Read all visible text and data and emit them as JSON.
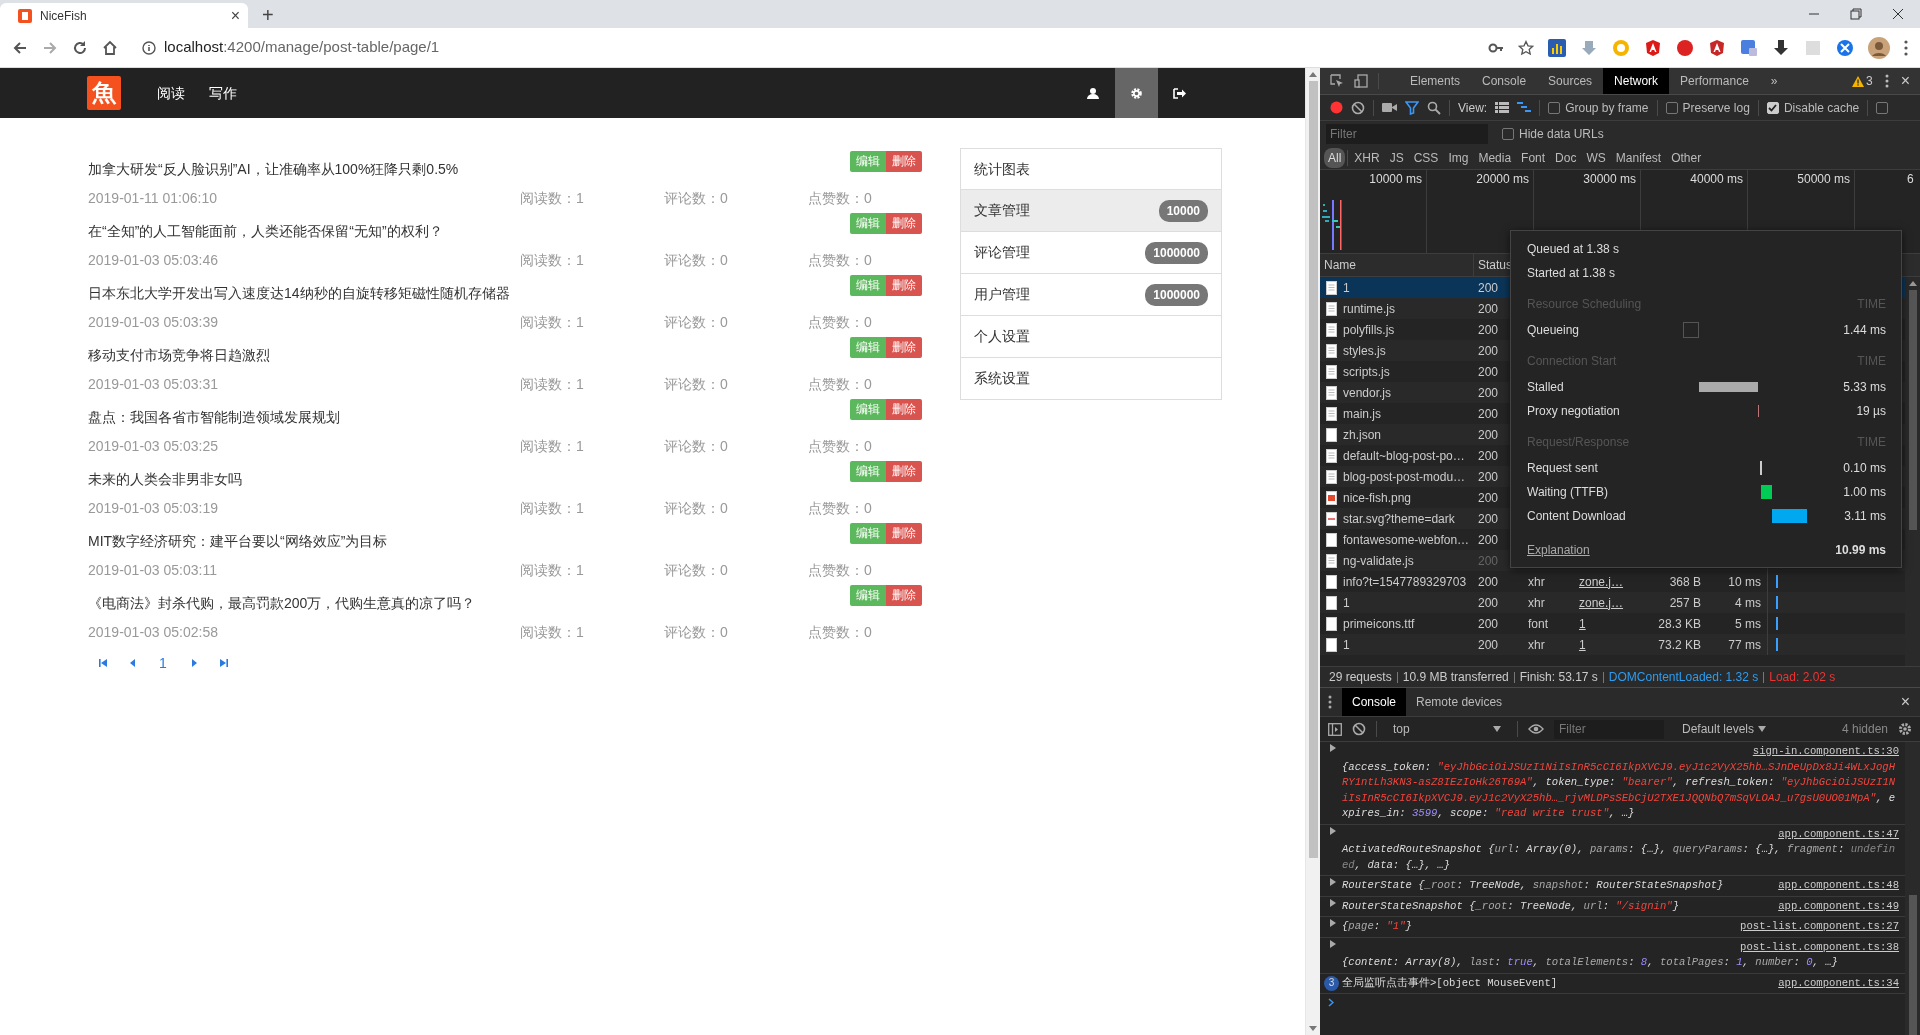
{
  "browser": {
    "tab_title": "NiceFish",
    "tab_close": "×",
    "new_tab": "+",
    "url_host": "localhost",
    "url_path": ":4200/manage/post-table/page/1"
  },
  "navbar": {
    "logo": "魚",
    "links": [
      {
        "label": "阅读"
      },
      {
        "label": "写作"
      }
    ],
    "actions": [
      {
        "kind": "user",
        "selected": false
      },
      {
        "kind": "gear",
        "selected": true
      },
      {
        "kind": "signout",
        "selected": false
      }
    ]
  },
  "posts": [
    {
      "title": "加拿大研发“反人脸识别”AI，让准确率从100%狂降只剩0.5%",
      "date": "2019-01-11 01:06:10",
      "reads": "阅读数：1",
      "comments": "评论数：0",
      "likes": "点赞数：0",
      "edit": "编辑",
      "delete": "删除"
    },
    {
      "title": "在“全知”的人工智能面前，人类还能否保留“无知”的权利？",
      "date": "2019-01-03 05:03:46",
      "reads": "阅读数：1",
      "comments": "评论数：0",
      "likes": "点赞数：0",
      "edit": "编辑",
      "delete": "删除"
    },
    {
      "title": "日本东北大学开发出写入速度达14纳秒的自旋转移矩磁性随机存储器",
      "date": "2019-01-03 05:03:39",
      "reads": "阅读数：1",
      "comments": "评论数：0",
      "likes": "点赞数：0",
      "edit": "编辑",
      "delete": "删除"
    },
    {
      "title": "移动支付市场竞争将日趋激烈",
      "date": "2019-01-03 05:03:31",
      "reads": "阅读数：1",
      "comments": "评论数：0",
      "likes": "点赞数：0",
      "edit": "编辑",
      "delete": "删除"
    },
    {
      "title": "盘点：我国各省市智能制造领域发展规划",
      "date": "2019-01-03 05:03:25",
      "reads": "阅读数：1",
      "comments": "评论数：0",
      "likes": "点赞数：0",
      "edit": "编辑",
      "delete": "删除"
    },
    {
      "title": "未来的人类会非男非女吗",
      "date": "2019-01-03 05:03:19",
      "reads": "阅读数：1",
      "comments": "评论数：0",
      "likes": "点赞数：0",
      "edit": "编辑",
      "delete": "删除"
    },
    {
      "title": "MIT数字经济研究：建平台要以“网络效应”为目标",
      "date": "2019-01-03 05:03:11",
      "reads": "阅读数：1",
      "comments": "评论数：0",
      "likes": "点赞数：0",
      "edit": "编辑",
      "delete": "删除"
    },
    {
      "title": "《电商法》封杀代购，最高罚款200万，代购生意真的凉了吗？",
      "date": "2019-01-03 05:02:58",
      "reads": "阅读数：1",
      "comments": "评论数：0",
      "likes": "点赞数：0",
      "edit": "编辑",
      "delete": "删除"
    }
  ],
  "pagination": {
    "current": "1"
  },
  "admin_menu": [
    {
      "label": "统计图表",
      "selected": false
    },
    {
      "label": "文章管理",
      "badge": "10000",
      "selected": true
    },
    {
      "label": "评论管理",
      "badge": "1000000",
      "selected": false
    },
    {
      "label": "用户管理",
      "badge": "1000000",
      "selected": false
    },
    {
      "label": "个人设置",
      "selected": false
    },
    {
      "label": "系统设置",
      "selected": false
    }
  ],
  "devtools": {
    "tabs": [
      {
        "label": "Elements",
        "selected": false
      },
      {
        "label": "Console",
        "selected": false
      },
      {
        "label": "Sources",
        "selected": false
      },
      {
        "label": "Network",
        "selected": true
      },
      {
        "label": "Performance",
        "selected": false
      }
    ],
    "more": "»",
    "warnings": "3",
    "close": "×",
    "recording": true,
    "view_label": "View:",
    "options": [
      {
        "label": "Group by frame",
        "checked": false
      },
      {
        "label": "Preserve log",
        "checked": false
      },
      {
        "label": "Disable cache",
        "checked": true
      },
      {
        "checked": false
      }
    ],
    "filter_placeholder": "Filter",
    "hide_data_urls": {
      "label": "Hide data URLs",
      "checked": false
    },
    "types": [
      {
        "label": "All",
        "selected": true
      },
      {
        "label": "XHR",
        "selected": false
      },
      {
        "label": "JS",
        "selected": false
      },
      {
        "label": "CSS",
        "selected": false
      },
      {
        "label": "Img",
        "selected": false
      },
      {
        "label": "Media",
        "selected": false
      },
      {
        "label": "Font",
        "selected": false
      },
      {
        "label": "Doc",
        "selected": false
      },
      {
        "label": "WS",
        "selected": false
      },
      {
        "label": "Manifest",
        "selected": false
      },
      {
        "label": "Other",
        "selected": false
      }
    ],
    "overview_ticks": [
      "10000 ms",
      "20000 ms",
      "30000 ms",
      "40000 ms",
      "50000 ms",
      "6"
    ],
    "columns": [
      "Name",
      "Status"
    ],
    "requests": [
      {
        "name": "1",
        "status": "200",
        "kind": "doc",
        "dimmed": false,
        "selected": true
      },
      {
        "name": "runtime.js",
        "status": "200",
        "kind": "doc",
        "dimmed": false,
        "selected": false
      },
      {
        "name": "polyfills.js",
        "status": "200",
        "kind": "doc",
        "dimmed": false,
        "selected": false
      },
      {
        "name": "styles.js",
        "status": "200",
        "kind": "doc",
        "dimmed": false,
        "selected": false
      },
      {
        "name": "scripts.js",
        "status": "200",
        "kind": "doc",
        "dimmed": false,
        "selected": false
      },
      {
        "name": "vendor.js",
        "status": "200",
        "kind": "doc",
        "dimmed": false,
        "selected": false
      },
      {
        "name": "main.js",
        "status": "200",
        "kind": "doc",
        "dimmed": false,
        "selected": false
      },
      {
        "name": "zh.json",
        "status": "200",
        "kind": "blank",
        "dimmed": false,
        "selected": false
      },
      {
        "name": "default~blog-post-po…",
        "status": "200",
        "kind": "doc",
        "dimmed": false,
        "selected": false
      },
      {
        "name": "blog-post-post-modu…",
        "status": "200",
        "kind": "doc",
        "dimmed": false,
        "selected": false
      },
      {
        "name": "nice-fish.png",
        "status": "200",
        "kind": "image",
        "dimmed": false,
        "selected": false
      },
      {
        "name": "star.svg?theme=dark",
        "status": "200",
        "kind": "svg",
        "dimmed": false,
        "selected": false
      },
      {
        "name": "fontawesome-webfon…",
        "status": "200",
        "kind": "blank",
        "dimmed": false,
        "selected": false
      },
      {
        "name": "ng-validate.js",
        "status": "200",
        "kind": "doc",
        "dimmed": true,
        "selected": false
      },
      {
        "name": "info?t=1547789329703",
        "status": "200",
        "type": "xhr",
        "initiator": "zone.j…",
        "size": "368 B",
        "time": "10 ms",
        "kind": "blank",
        "dimmed": false,
        "selected": false
      },
      {
        "name": "1",
        "status": "200",
        "type": "xhr",
        "initiator": "zone.j…",
        "size": "257 B",
        "time": "4 ms",
        "kind": "blank",
        "dimmed": false,
        "selected": false
      },
      {
        "name": "primeicons.ttf",
        "status": "200",
        "type": "font",
        "initiator": "1",
        "size": "28.3 KB",
        "time": "5 ms",
        "kind": "blank",
        "dimmed": false,
        "selected": false
      },
      {
        "name": "1",
        "status": "200",
        "type": "xhr",
        "initiator": "1",
        "size": "73.2 KB",
        "time": "77 ms",
        "kind": "blank",
        "dimmed": false,
        "selected": false
      }
    ],
    "timing": {
      "queued": "Queued at 1.38 s",
      "started": "Started at 1.38 s",
      "sections": [
        {
          "heading": "Resource Scheduling",
          "time_label": "TIME",
          "phases": [
            {
              "label": "Queueing",
              "value": "1.44 ms",
              "kind": "queueing"
            }
          ]
        },
        {
          "heading": "Connection Start",
          "time_label": "TIME",
          "phases": [
            {
              "label": "Stalled",
              "value": "5.33 ms",
              "kind": "stalled"
            },
            {
              "label": "Proxy negotiation",
              "value": "19 µs",
              "kind": "proxy"
            }
          ]
        },
        {
          "heading": "Request/Response",
          "time_label": "TIME",
          "phases": [
            {
              "label": "Request sent",
              "value": "0.10 ms",
              "kind": "sent"
            },
            {
              "label": "Waiting (TTFB)",
              "value": "1.00 ms",
              "kind": "waiting"
            },
            {
              "label": "Content Download",
              "value": "3.11 ms",
              "kind": "download"
            }
          ]
        }
      ],
      "explanation": "Explanation",
      "total": "10.99 ms"
    },
    "summary": [
      {
        "text": "29 requests",
        "kind": "plain"
      },
      {
        "text": "10.9 MB transferred",
        "kind": "plain"
      },
      {
        "text": "Finish: 53.17 s",
        "kind": "plain"
      },
      {
        "text": "DOMContentLoaded: 1.32 s",
        "kind": "dcl"
      },
      {
        "text": "Load: 2.02 s",
        "kind": "load"
      }
    ],
    "drawer": {
      "tabs": [
        {
          "label": "Console",
          "selected": true
        },
        {
          "label": "Remote devices",
          "selected": false
        }
      ],
      "close": "×",
      "context": "top",
      "filter_placeholder": "Filter",
      "levels": "Default levels",
      "hidden": "4 hidden",
      "messages": [
        {
          "kind": "object",
          "source": "sign-in.component.ts:30",
          "parts": [
            {
              "text": "{access_token: ",
              "kind": "plain"
            },
            {
              "text": "\"eyJhbGciOiJSUzI1NiIsInR5cCI6IkpXVCJ9.eyJ1c2VyX25hb…SJnDeUpDx8Ji4WLxJogHRY1ntLh3KN3-asZ8IEzIoHk26T69A\"",
              "kind": "str"
            },
            {
              "text": ", token_type: ",
              "kind": "plain"
            },
            {
              "text": "\"bearer\"",
              "kind": "str"
            },
            {
              "text": ", refresh_token: ",
              "kind": "plain"
            },
            {
              "text": "\"eyJhbGciOiJSUzI1NiIsInR5cCI6IkpXVCJ9.eyJ1c2VyX25hb…_rjvMLDPsSEbCjU2TXE1JQQNbQ7mSqVLOAJ_u7gsU0UO01MpA\"",
              "kind": "str"
            },
            {
              "text": ", expires_in: ",
              "kind": "plain"
            },
            {
              "text": "3599",
              "kind": "num"
            },
            {
              "text": ", scope: ",
              "kind": "plain"
            },
            {
              "text": "\"read write trust\"",
              "kind": "str"
            },
            {
              "text": ", …}",
              "kind": "plain"
            }
          ]
        },
        {
          "kind": "object",
          "source": "app.component.ts:47",
          "parts": [
            {
              "text": "ActivatedRouteSnapshot {",
              "kind": "plain"
            },
            {
              "text": "url",
              "kind": "key"
            },
            {
              "text": ": Array(0), ",
              "kind": "plain"
            },
            {
              "text": "params",
              "kind": "key"
            },
            {
              "text": ": {…}, ",
              "kind": "plain"
            },
            {
              "text": "queryParams",
              "kind": "key"
            },
            {
              "text": ": {…}, ",
              "kind": "plain"
            },
            {
              "text": "fragment",
              "kind": "key"
            },
            {
              "text": ": ",
              "kind": "plain"
            },
            {
              "text": "undefined",
              "kind": "dim"
            },
            {
              "text": ", data: {…}, …}",
              "kind": "plain"
            }
          ]
        },
        {
          "kind": "object",
          "source": "app.component.ts:48",
          "parts": [
            {
              "text": "RouterState {",
              "kind": "plain"
            },
            {
              "text": "_root",
              "kind": "key"
            },
            {
              "text": ": TreeNode, ",
              "kind": "plain"
            },
            {
              "text": "snapshot",
              "kind": "key"
            },
            {
              "text": ": RouterStateSnapshot}",
              "kind": "plain"
            }
          ]
        },
        {
          "kind": "object",
          "source": "app.component.ts:49",
          "parts": [
            {
              "text": "RouterStateSnapshot {",
              "kind": "plain"
            },
            {
              "text": "_root",
              "kind": "key"
            },
            {
              "text": ": TreeNode, ",
              "kind": "plain"
            },
            {
              "text": "url",
              "kind": "key"
            },
            {
              "text": ": ",
              "kind": "plain"
            },
            {
              "text": "\"/signin\"",
              "kind": "str"
            },
            {
              "text": "}",
              "kind": "plain"
            }
          ]
        },
        {
          "kind": "object",
          "source": "post-list.component.ts:27",
          "parts": [
            {
              "text": "{",
              "kind": "plain"
            },
            {
              "text": "page",
              "kind": "key"
            },
            {
              "text": ": ",
              "kind": "plain"
            },
            {
              "text": "\"1\"",
              "kind": "str"
            },
            {
              "text": "}",
              "kind": "plain"
            }
          ]
        },
        {
          "kind": "object",
          "source": "post-list.component.ts:38",
          "parts": [
            {
              "text": "{content: Array(8), ",
              "kind": "plain"
            },
            {
              "text": "last",
              "kind": "key"
            },
            {
              "text": ": ",
              "kind": "plain"
            },
            {
              "text": "true",
              "kind": "num"
            },
            {
              "text": ", ",
              "kind": "plain"
            },
            {
              "text": "totalElements",
              "kind": "key"
            },
            {
              "text": ": ",
              "kind": "plain"
            },
            {
              "text": "8",
              "kind": "num"
            },
            {
              "text": ", ",
              "kind": "plain"
            },
            {
              "text": "totalPages",
              "kind": "key"
            },
            {
              "text": ": ",
              "kind": "plain"
            },
            {
              "text": "1",
              "kind": "num"
            },
            {
              "text": ", ",
              "kind": "plain"
            },
            {
              "text": "number",
              "kind": "key"
            },
            {
              "text": ": ",
              "kind": "plain"
            },
            {
              "text": "0",
              "kind": "num"
            },
            {
              "text": ", …}",
              "kind": "plain"
            }
          ]
        },
        {
          "kind": "text",
          "count": "3",
          "source": "app.component.ts:34",
          "parts": [
            {
              "text": "全局监听点击事件>[object MouseEvent]",
              "kind": "plain"
            }
          ]
        }
      ]
    }
  }
}
